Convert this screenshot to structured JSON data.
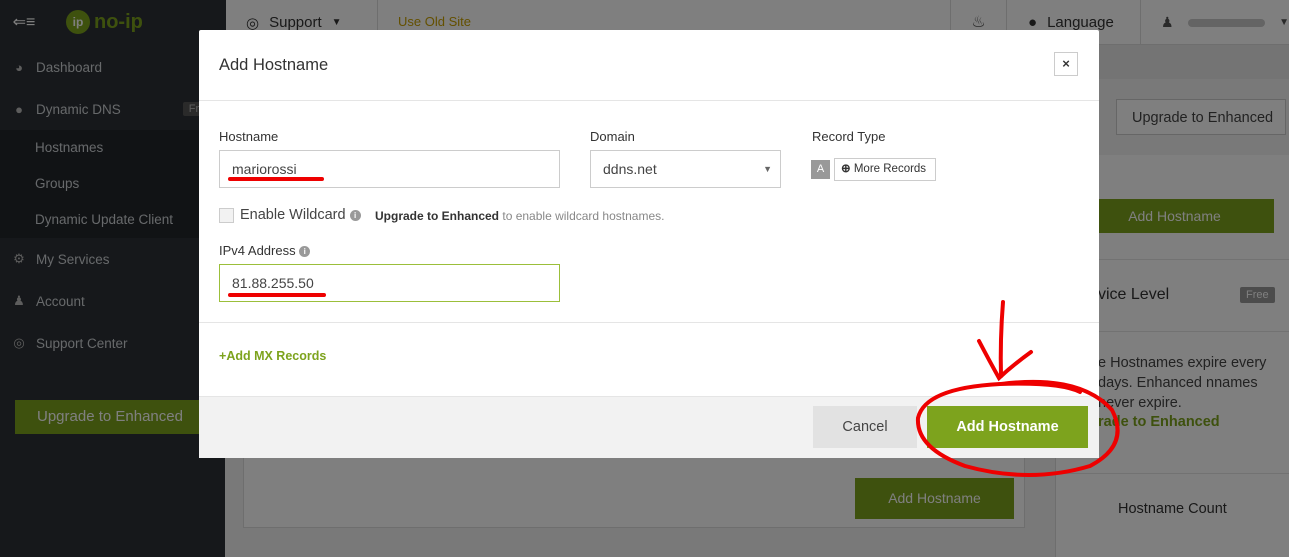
{
  "topbar": {
    "menu_icon": "collapse-menu-icon",
    "logo_text": "no-ip",
    "support_label": "Support",
    "old_site_label": "Use Old Site",
    "language_label": "Language"
  },
  "sidebar": {
    "items": [
      {
        "label": "Dashboard",
        "icon": "dashboard-icon"
      },
      {
        "label": "Dynamic DNS",
        "icon": "globe-icon",
        "badge": "Free"
      },
      {
        "label": "Hostnames"
      },
      {
        "label": "Groups"
      },
      {
        "label": "Dynamic Update Client"
      },
      {
        "label": "My Services",
        "icon": "gear-icon"
      },
      {
        "label": "Account",
        "icon": "user-icon"
      },
      {
        "label": "Support Center",
        "icon": "lifebuoy-icon"
      }
    ],
    "upgrade_label": "Upgrade to Enhanced"
  },
  "background": {
    "upgrade_button": "Upgrade to Enhanced",
    "add_hostname_top": "Add Hostname",
    "add_hostname_bottom": "Add Hostname",
    "service_level": "vice Level",
    "free_badge": "Free",
    "expire_text": "e Hostnames expire every days. Enhanced nnames never expire.",
    "upgrade_link": "rade to Enhanced",
    "hostname_count": "Hostname Count"
  },
  "modal": {
    "title": "Add Hostname",
    "close_label": "×",
    "hostname_label": "Hostname",
    "hostname_value": "mariorossi",
    "domain_label": "Domain",
    "domain_value": "ddns.net",
    "record_type_label": "Record Type",
    "record_type_value": "A",
    "more_records_label": "More Records",
    "wildcard_label": "Enable Wildcard",
    "wildcard_upgrade": "Upgrade to Enhanced",
    "wildcard_note": "to enable wildcard hostnames.",
    "ipv4_label": "IPv4 Address",
    "ipv4_value": "81.88.255.50",
    "add_mx_label": "Add MX Records",
    "cancel_label": "Cancel",
    "add_label": "Add Hostname"
  },
  "colors": {
    "accent": "#7da31d",
    "sidebar": "#2d3136",
    "annotation": "#e00000"
  }
}
